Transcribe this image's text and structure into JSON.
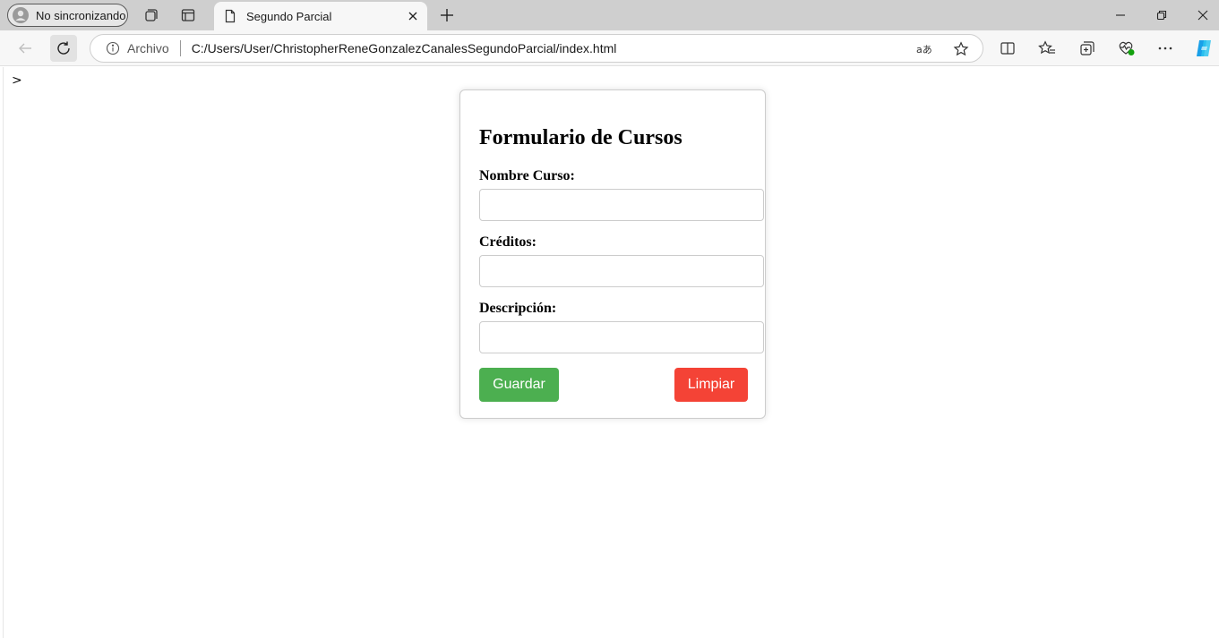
{
  "browser": {
    "profile_label": "No sincronizando",
    "tab_title": "Segundo Parcial",
    "address": {
      "origin_label": "Archivo",
      "url": "C:/Users/User/ChristopherReneGonzalezCanalesSegundoParcial/index.html"
    },
    "icons": {
      "workspaces": "workspaces-icon",
      "tab_actions": "tab-actions-icon",
      "page": "document-icon",
      "close_tab": "close-icon",
      "new_tab": "plus-icon",
      "minimize": "minimize-icon",
      "restore": "restore-icon",
      "close_window": "close-window-icon",
      "back": "back-arrow-icon",
      "refresh": "refresh-icon",
      "info": "info-icon",
      "read_aloud": "read-aloud-icon",
      "favorite": "star-icon",
      "split_screen": "split-screen-icon",
      "favorites": "favorites-icon",
      "collections": "collections-icon",
      "performance": "heart-pulse-icon",
      "more": "more-icon",
      "copilot": "copilot-icon"
    }
  },
  "page": {
    "stray_text": ">",
    "form": {
      "title": "Formulario de Cursos",
      "fields": [
        {
          "label": "Nombre Curso:",
          "value": ""
        },
        {
          "label": "Créditos:",
          "value": ""
        },
        {
          "label": "Descripción:",
          "value": ""
        }
      ],
      "save_label": "Guardar",
      "clear_label": "Limpiar"
    }
  },
  "colors": {
    "save_button": "#4caf50",
    "clear_button": "#f44336",
    "copilot": "#1aa0e8"
  }
}
